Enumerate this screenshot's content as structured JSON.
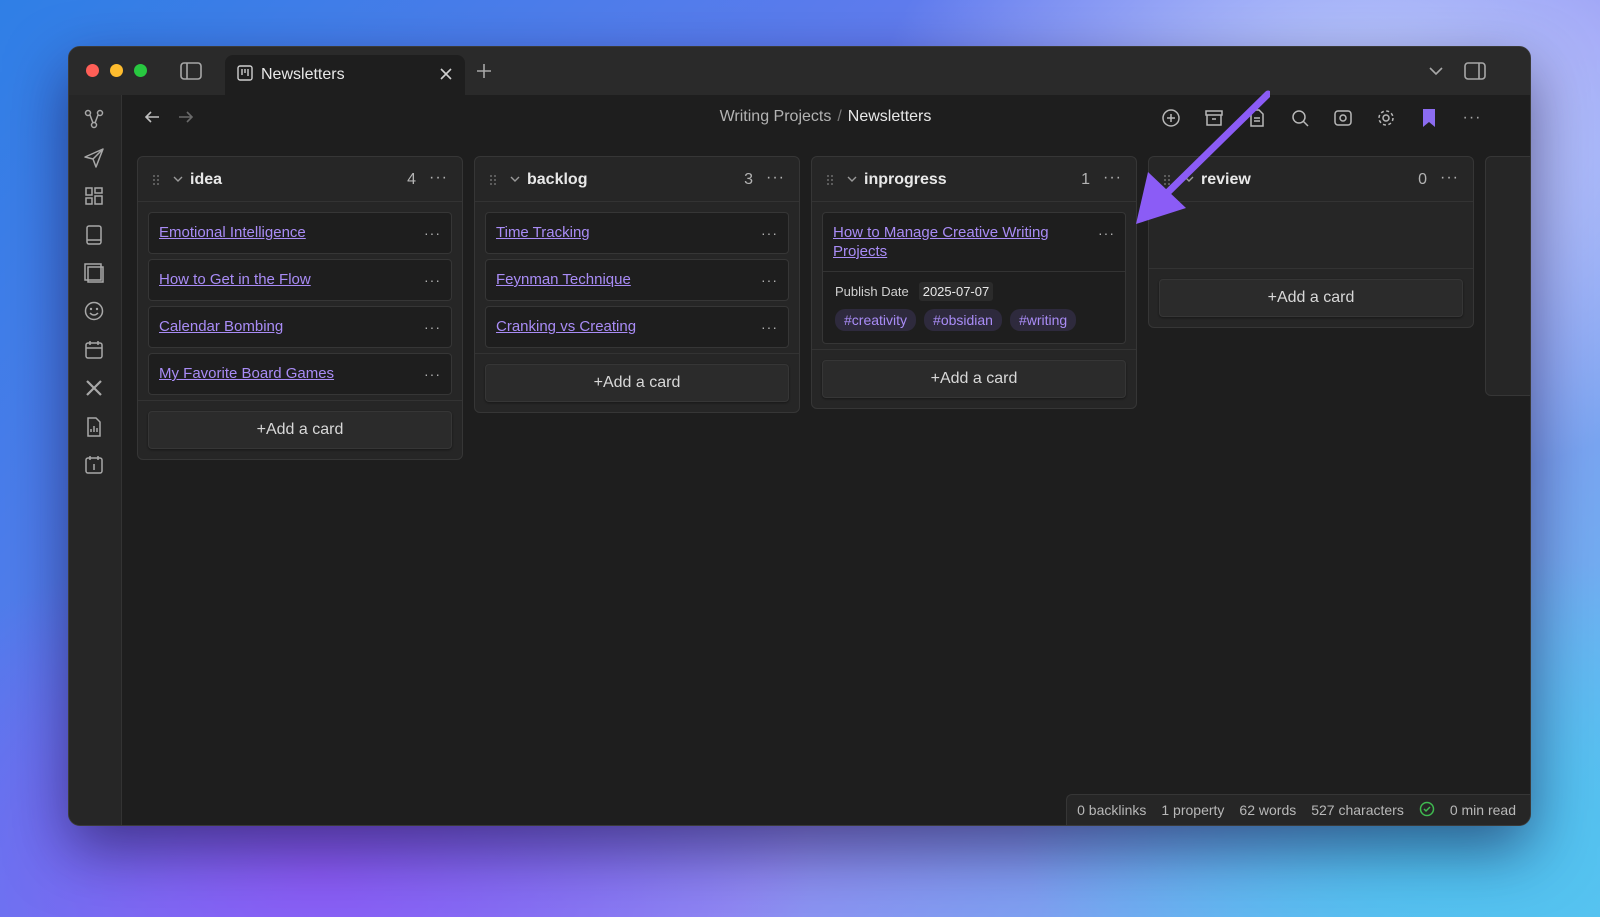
{
  "tab": {
    "title": "Newsletters"
  },
  "breadcrumb": {
    "parent": "Writing Projects",
    "separator": "/",
    "current": "Newsletters"
  },
  "lanes": [
    {
      "title": "idea",
      "count": "4",
      "cards": [
        {
          "title": "Emotional Intelligence"
        },
        {
          "title": "How to Get in the Flow"
        },
        {
          "title": "Calendar Bombing"
        },
        {
          "title": "My Favorite Board Games"
        }
      ],
      "add_label": "+Add a card"
    },
    {
      "title": "backlog",
      "count": "3",
      "cards": [
        {
          "title": "Time Tracking"
        },
        {
          "title": "Feynman Technique"
        },
        {
          "title": "Cranking vs Creating"
        }
      ],
      "add_label": "+Add a card"
    },
    {
      "title": "inprogress",
      "count": "1",
      "cards": [
        {
          "title": "How to Manage Creative Writing Projects",
          "property_label": "Publish Date",
          "property_value": "2025-07-07",
          "tags": [
            "#creativity",
            "#obsidian",
            "#writing"
          ]
        }
      ],
      "add_label": "+Add a card"
    },
    {
      "title": "review",
      "count": "0",
      "cards": [],
      "add_label": "+Add a card"
    }
  ],
  "status": {
    "backlinks": "0 backlinks",
    "properties": "1 property",
    "words": "62 words",
    "characters": "527 characters",
    "read_time": "0 min read"
  },
  "more_glyph": "···",
  "colors": {
    "accent": "#a98cf6",
    "annotation_arrow": "#8b5cf6",
    "sync_ok": "#3fb950"
  }
}
